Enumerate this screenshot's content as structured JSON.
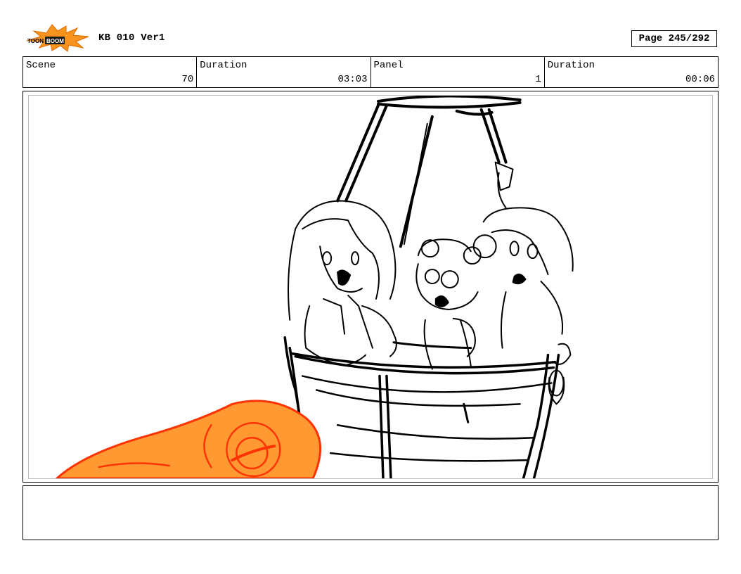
{
  "header": {
    "logo_text": "TOON BOOM",
    "doc_title": "KB 010 Ver1",
    "page_label": "Page 245/292"
  },
  "info_bar": {
    "scene_label": "Scene",
    "scene_value": "70",
    "scene_duration_label": "Duration",
    "scene_duration_value": "03:03",
    "panel_label": "Panel",
    "panel_value": "1",
    "panel_duration_label": "Duration",
    "panel_duration_value": "00:06"
  },
  "panel": {
    "image_content": "storyboard-sketch",
    "accent_color": "#ff8c1a",
    "line_color": "#000000"
  },
  "notes": {
    "text": ""
  }
}
